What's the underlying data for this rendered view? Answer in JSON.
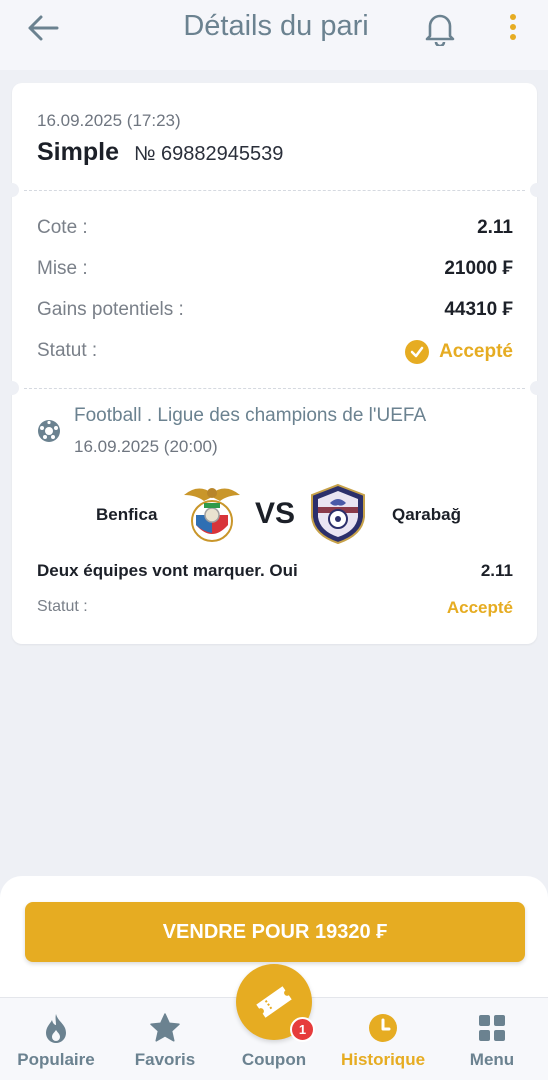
{
  "header": {
    "title": "Détails du pari"
  },
  "bet": {
    "datetime": "16.09.2025 (17:23)",
    "type": "Simple",
    "number": "№ 69882945539",
    "rows": [
      {
        "label": "Cote :",
        "value": "2.11"
      },
      {
        "label": "Mise :",
        "value": "21000 ₣"
      },
      {
        "label": "Gains potentiels :",
        "value": "44310 ₣"
      },
      {
        "label": "Statut :",
        "value": "Accepté"
      }
    ]
  },
  "event": {
    "league": "Football . Ligue des champions de l'UEFA",
    "datetime": "16.09.2025 (20:00)",
    "team_home": "Benfica",
    "vs": "VS",
    "team_away": "Qarabağ",
    "market": "Deux équipes vont marquer. Oui",
    "odds": "2.11",
    "status_label": "Statut :",
    "status_value": "Accepté"
  },
  "sell_button": "VENDRE POUR 19320 ₣",
  "nav": {
    "items": [
      {
        "label": "Populaire",
        "icon": "flame-icon"
      },
      {
        "label": "Favoris",
        "icon": "star-icon"
      },
      {
        "label": "Coupon",
        "icon": "ticket-icon"
      },
      {
        "label": "Historique",
        "icon": "clock-icon"
      },
      {
        "label": "Menu",
        "icon": "grid-icon"
      }
    ],
    "coupon_badge": "1"
  },
  "colors": {
    "accent": "#e6ac22",
    "muted_blue": "#6b8290",
    "badge": "#e63c3c",
    "background": "#eef0f5"
  }
}
